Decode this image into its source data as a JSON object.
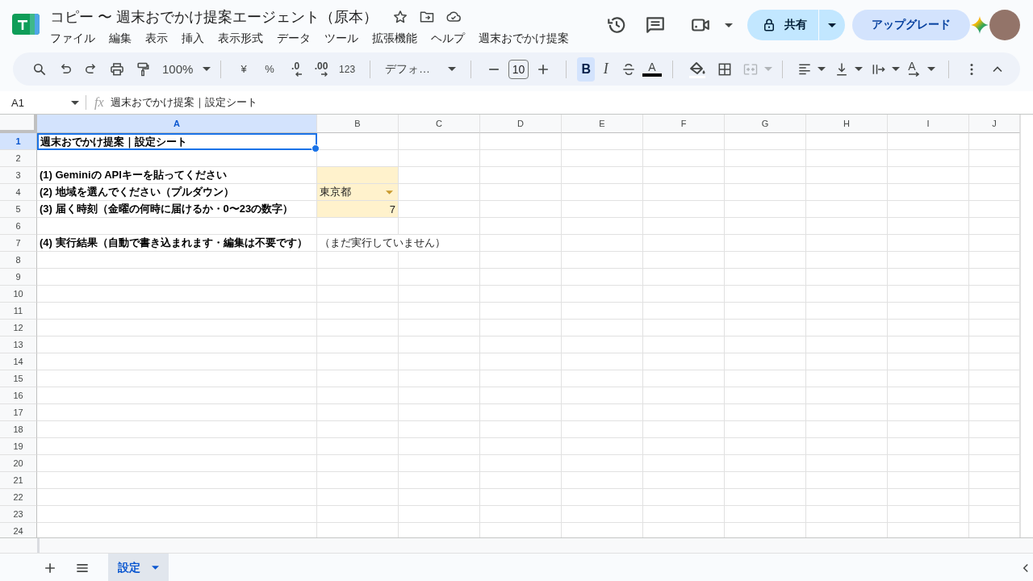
{
  "document": {
    "title": "コピー 〜 週末おでかけ提案エージェント（原本）",
    "menus": [
      "ファイル",
      "編集",
      "表示",
      "挿入",
      "表示形式",
      "データ",
      "ツール",
      "拡張機能",
      "ヘルプ",
      "週末おでかけ提案"
    ]
  },
  "header": {
    "share_label": "共有",
    "upgrade_label": "アップグレード"
  },
  "toolbar": {
    "zoom": "100%",
    "currency": "¥",
    "percent": "%",
    "decimal_decrease": ".0",
    "decimal_increase": ".00",
    "number_format": "123",
    "font": "デフォ…",
    "font_size": "10",
    "bold_label": "B",
    "bold_on": true,
    "italic_label": "I",
    "italic_on": false,
    "text_color_label": "A",
    "merge_disabled": true,
    "rotation_label": "A"
  },
  "formula_bar": {
    "cell_ref": "A1",
    "function_label": "fx",
    "content": "週末おでかけ提案｜設定シート"
  },
  "sheet": {
    "columns": [
      {
        "label": "A",
        "selected": true
      },
      {
        "label": "B",
        "selected": false
      },
      {
        "label": "C",
        "selected": false
      },
      {
        "label": "D",
        "selected": false
      },
      {
        "label": "E",
        "selected": false
      },
      {
        "label": "F",
        "selected": false
      },
      {
        "label": "G",
        "selected": false
      },
      {
        "label": "H",
        "selected": false
      },
      {
        "label": "I",
        "selected": false
      },
      {
        "label": "J",
        "selected": false
      }
    ],
    "rows": [
      {
        "label": "1",
        "selected": true,
        "cells": [
          {
            "kind": "text",
            "text": "週末おでかけ提案｜設定シート",
            "bold": true,
            "highlighted": false,
            "selected": true
          }
        ]
      },
      {
        "label": "2",
        "selected": false
      },
      {
        "label": "3",
        "selected": false,
        "cells": [
          {
            "kind": "text",
            "text": "(1) Geminiの APIキーを貼ってください",
            "bold": true,
            "highlighted": false,
            "selected": false
          },
          {
            "kind": "empty",
            "highlighted": true,
            "selected": false
          }
        ]
      },
      {
        "label": "4",
        "selected": false,
        "cells": [
          {
            "kind": "text",
            "text": "(2) 地域を選んでください（プルダウン）",
            "bold": true,
            "highlighted": false,
            "selected": false
          },
          {
            "kind": "dropdown",
            "text": "東京都",
            "bold": false,
            "highlighted": true,
            "selected": false
          }
        ]
      },
      {
        "label": "5",
        "selected": false,
        "cells": [
          {
            "kind": "text",
            "text": "(3) 届く時刻（金曜の何時に届けるか・0〜23の数字）",
            "bold": true,
            "highlighted": false,
            "selected": false
          },
          {
            "kind": "number",
            "text": "7",
            "bold": false,
            "highlighted": true,
            "selected": false
          }
        ]
      },
      {
        "label": "6",
        "selected": false
      },
      {
        "label": "7",
        "selected": false,
        "cells": [
          {
            "kind": "text",
            "text": "(4) 実行結果（自動で書き込まれます・編集は不要です）",
            "bold": true,
            "highlighted": false,
            "selected": false
          },
          {
            "kind": "text",
            "text": "（まだ実行していません）",
            "bold": false,
            "highlighted": false,
            "selected": false
          }
        ]
      },
      {
        "label": "8",
        "selected": false
      },
      {
        "label": "9",
        "selected": false
      },
      {
        "label": "10",
        "selected": false
      },
      {
        "label": "11",
        "selected": false
      },
      {
        "label": "12",
        "selected": false
      },
      {
        "label": "13",
        "selected": false
      },
      {
        "label": "14",
        "selected": false
      },
      {
        "label": "15",
        "selected": false
      },
      {
        "label": "16",
        "selected": false
      },
      {
        "label": "17",
        "selected": false
      },
      {
        "label": "18",
        "selected": false
      },
      {
        "label": "19",
        "selected": false
      },
      {
        "label": "20",
        "selected": false
      },
      {
        "label": "21",
        "selected": false
      },
      {
        "label": "22",
        "selected": false
      },
      {
        "label": "23",
        "selected": false
      },
      {
        "label": "24",
        "selected": false
      }
    ]
  },
  "sheet_tabs": [
    {
      "label": "設定",
      "selected": true
    }
  ]
}
